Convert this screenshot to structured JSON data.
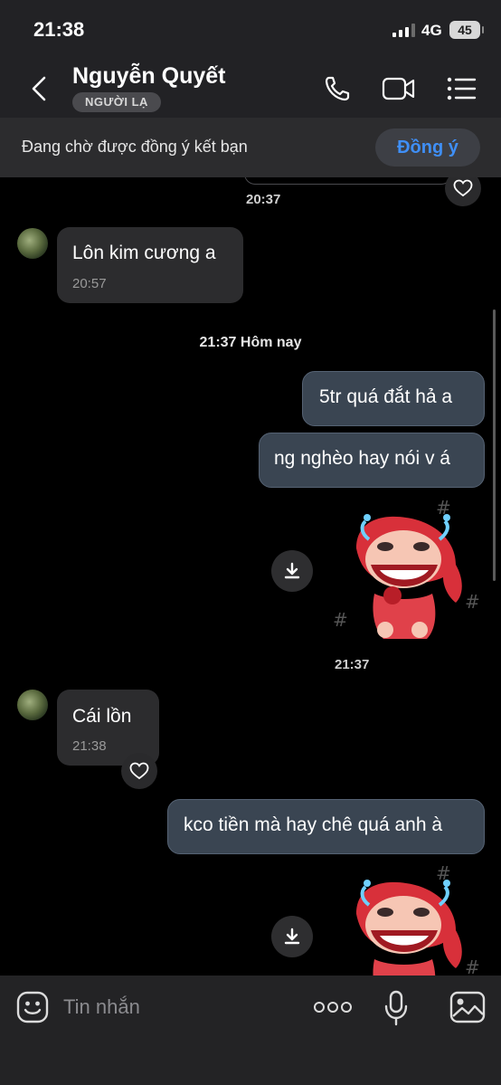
{
  "status_bar": {
    "time": "21:38",
    "network": "4G",
    "battery": "45"
  },
  "header": {
    "contact_name": "Nguyễn Quyết",
    "badge": "NGƯỜI LẠ"
  },
  "friend_request": {
    "text": "Đang chờ được đồng ý kết bạn",
    "accept_label": "Đồng ý"
  },
  "messages": {
    "prev_time": "20:37",
    "m1": {
      "text": "Lôn kim cương a",
      "time": "20:57"
    },
    "date_separator": "21:37 Hôm nay",
    "m2": {
      "text": "5tr quá đắt hả a"
    },
    "m3": {
      "text": "ng nghèo hay nói v á"
    },
    "sticker1_time": "21:37",
    "m4": {
      "text": "Cái lồn",
      "time": "21:38"
    },
    "m5": {
      "text": "kco tiền mà hay chê quá anh à"
    }
  },
  "composer": {
    "placeholder": "Tin nhắn"
  },
  "colors": {
    "accent": "#3f8ff7",
    "header_bg": "#222225",
    "bubble_out": "#3a4552",
    "bubble_in": "#2c2c2e"
  },
  "icons": [
    "back-icon",
    "phone-icon",
    "video-icon",
    "menu-icon",
    "heart-icon",
    "download-icon",
    "emoji-icon",
    "more-icon",
    "mic-icon",
    "image-icon"
  ]
}
